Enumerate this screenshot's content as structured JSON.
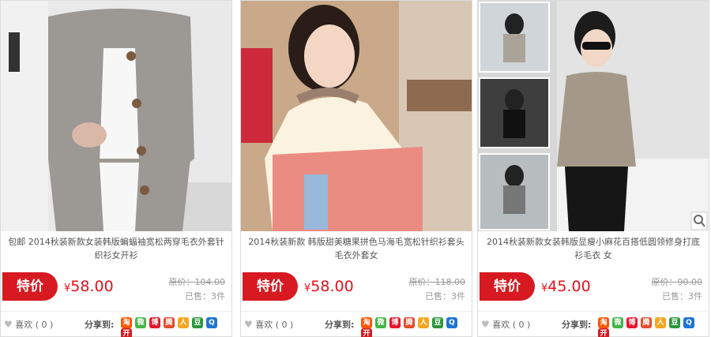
{
  "products": [
    {
      "title": "2014秋装新款 韩版甜美糖果拼色马海毛宽松针织衫套头毛衣外套女",
      "badge": "特价",
      "currency": "¥",
      "price": "58.00",
      "original_price": "原价：118.00",
      "sold": "已售：3件",
      "like_label": "喜欢",
      "like_count": "( 0 )",
      "share_label": "分享到:"
    },
    {
      "title": "2014秋装新款女装韩版显瘦小麻花百搭低圆领修身打底衫毛衣 女",
      "badge": "特价",
      "currency": "¥",
      "price": "45.00",
      "original_price": "原价：90.00",
      "sold": "已售：3件",
      "like_label": "喜欢",
      "like_count": "( 0 )",
      "share_label": "分享到:"
    },
    {
      "title": "包邮 2014秋装新款女装韩版蝙蝠袖宽松两穿毛衣外套针织衫女开衫",
      "badge": "特价",
      "currency": "¥",
      "price": "58.00",
      "original_price": "原价：104.00",
      "sold": "已售：3件",
      "like_label": "喜欢",
      "like_count": "( 0 )",
      "share_label": "分享到:"
    }
  ],
  "share_icons": [
    {
      "name": "taobao-share-icon",
      "glyph": "淘",
      "color": "#ff5500"
    },
    {
      "name": "wechat-share-icon",
      "glyph": "微",
      "color": "#44b549"
    },
    {
      "name": "weibo-share-icon",
      "glyph": "博",
      "color": "#e6162d"
    },
    {
      "name": "tencent-weibo-share-icon",
      "glyph": "腾",
      "color": "#e44c2c"
    },
    {
      "name": "renren-share-icon",
      "glyph": "人",
      "color": "#f5a623"
    },
    {
      "name": "douban-share-icon",
      "glyph": "豆",
      "color": "#2e963d"
    },
    {
      "name": "qzone-share-icon",
      "glyph": "Q",
      "color": "#1f74d4"
    },
    {
      "name": "kaixin-share-icon",
      "glyph": "开",
      "color": "#d71a21"
    }
  ]
}
